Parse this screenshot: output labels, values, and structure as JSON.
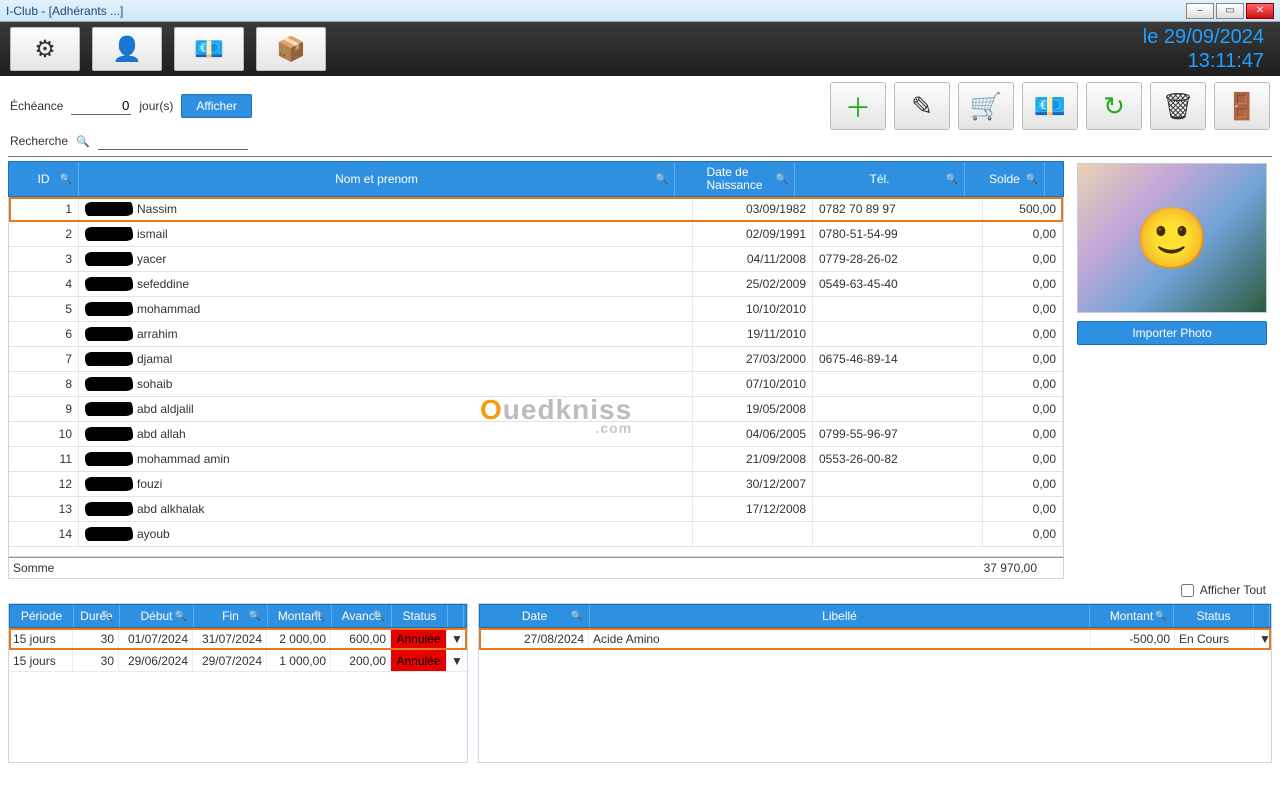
{
  "window": {
    "title": "I-Club - [Adhérants ...]",
    "minimize": "–",
    "maximize": "▭",
    "close": "✕"
  },
  "clock": {
    "date": "le 29/09/2024",
    "time": "13:11:47"
  },
  "toolbar_main": {
    "settings": "⚙",
    "user": "👤",
    "money": "💶",
    "cart": "📦"
  },
  "filters": {
    "echeance_label": "Échéance",
    "echeance_value": "0",
    "jours_label": "jour(s)",
    "afficher": "Afficher",
    "recherche_label": "Recherche"
  },
  "actions": {
    "add": "＋",
    "edit": "✎",
    "cart": "🛒",
    "pay": "💶",
    "refresh": "↻",
    "purge": "🗑",
    "exit": "🚪"
  },
  "members": {
    "headers": {
      "id": "ID",
      "name": "Nom et prenom",
      "dob": "Date de\nNaissance",
      "tel": "Tél.",
      "solde": "Solde"
    },
    "rows": [
      {
        "id": "1",
        "name": "Nassim",
        "dob": "03/09/1982",
        "tel": "0782 70 89 97",
        "solde": "500,00",
        "selected": true
      },
      {
        "id": "2",
        "name": "ismail",
        "dob": "02/09/1991",
        "tel": "0780-51-54-99",
        "solde": "0,00"
      },
      {
        "id": "3",
        "name": "yacer",
        "dob": "04/11/2008",
        "tel": "0779-28-26-02",
        "solde": "0,00"
      },
      {
        "id": "4",
        "name": "sefeddine",
        "dob": "25/02/2009",
        "tel": "0549-63-45-40",
        "solde": "0,00"
      },
      {
        "id": "5",
        "name": "mohammad",
        "dob": "10/10/2010",
        "tel": "",
        "solde": "0,00"
      },
      {
        "id": "6",
        "name": "arrahim",
        "dob": "19/11/2010",
        "tel": "",
        "solde": "0,00"
      },
      {
        "id": "7",
        "name": "djamal",
        "dob": "27/03/2000",
        "tel": "0675-46-89-14",
        "solde": "0,00"
      },
      {
        "id": "8",
        "name": "sohaib",
        "dob": "07/10/2010",
        "tel": "",
        "solde": "0,00"
      },
      {
        "id": "9",
        "name": "abd aldjalil",
        "dob": "19/05/2008",
        "tel": "",
        "solde": "0,00"
      },
      {
        "id": "10",
        "name": "abd allah",
        "dob": "04/06/2005",
        "tel": "0799-55-96-97",
        "solde": "0,00"
      },
      {
        "id": "11",
        "name": "mohammad amin",
        "dob": "21/09/2008",
        "tel": "0553-26-00-82",
        "solde": "0,00"
      },
      {
        "id": "12",
        "name": "fouzi",
        "dob": "30/12/2007",
        "tel": "",
        "solde": "0,00"
      },
      {
        "id": "13",
        "name": "abd alkhalak",
        "dob": "17/12/2008",
        "tel": "",
        "solde": "0,00"
      },
      {
        "id": "14",
        "name": "ayoub",
        "dob": "",
        "tel": "",
        "solde": "0,00"
      }
    ],
    "sum_label": "Somme",
    "sum_value": "37 970,00"
  },
  "photo": {
    "import_label": "Importer Photo"
  },
  "afficher_tout": "Afficher Tout",
  "subs": {
    "headers": {
      "periode": "Période",
      "duree": "Durée",
      "debut": "Début",
      "fin": "Fin",
      "montant": "Montant",
      "avance": "Avance",
      "status": "Status"
    },
    "rows": [
      {
        "periode": "15 jours",
        "duree": "30",
        "debut": "01/07/2024",
        "fin": "31/07/2024",
        "montant": "2 000,00",
        "avance": "600,00",
        "status": "Annulée",
        "selected": true
      },
      {
        "periode": "15 jours",
        "duree": "30",
        "debut": "29/06/2024",
        "fin": "29/07/2024",
        "montant": "1 000,00",
        "avance": "200,00",
        "status": "Annulée"
      }
    ]
  },
  "ledger": {
    "headers": {
      "date": "Date",
      "libelle": "Libellé",
      "montant": "Montant",
      "status": "Status"
    },
    "rows": [
      {
        "date": "27/08/2024",
        "libelle": "Acide Amino",
        "montant": "-500,00",
        "status": "En Cours",
        "selected": true
      }
    ]
  },
  "watermark": {
    "o": "O",
    "rest": "uedkniss",
    "com": ".com"
  },
  "glyphs": {
    "mag": "🔍",
    "dd": "▼"
  }
}
